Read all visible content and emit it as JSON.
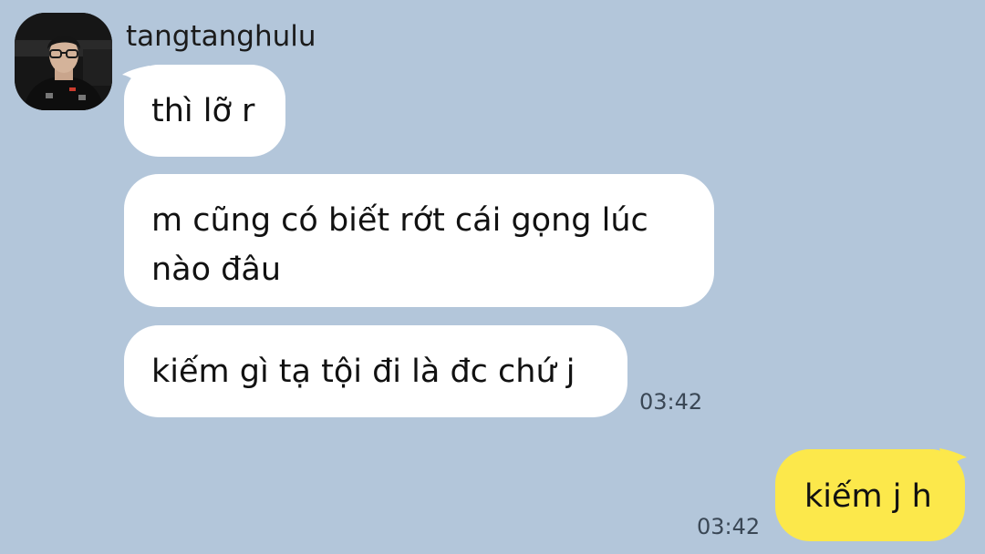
{
  "chat": {
    "contact_name": "tangtanghulu",
    "messages": [
      {
        "direction": "incoming",
        "text": "thì lỡ r"
      },
      {
        "direction": "incoming",
        "lines": [
          "m cũng có biết rớt cái gọng lúc",
          "nào đâu"
        ]
      },
      {
        "direction": "incoming",
        "text": "kiếm gì tạ tội đi là đc chứ j",
        "time": "03:42"
      },
      {
        "direction": "outgoing",
        "text": "kiếm j h",
        "time": "03:42"
      }
    ]
  },
  "colors": {
    "background": "#b3c6da",
    "incoming_bubble": "#ffffff",
    "outgoing_bubble": "#fce84b"
  },
  "icons": {
    "avatar": "contact-avatar-photo"
  }
}
